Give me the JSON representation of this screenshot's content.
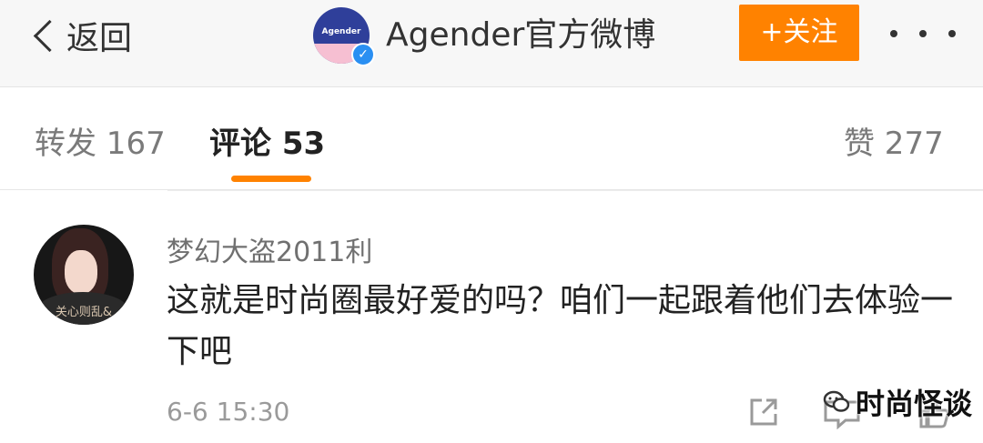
{
  "header": {
    "back_label": "返回",
    "account_avatar_text": "Agender",
    "account_name": "Agender官方微博",
    "follow_label": "+关注"
  },
  "tabs": [
    {
      "label": "转发 167"
    },
    {
      "label": "评论 53"
    },
    {
      "label": "赞 277"
    }
  ],
  "comment": {
    "username": "梦幻大盗2011利",
    "text": "这就是时尚圈最好爱的吗？咱们一起跟着他们去体验一下吧",
    "time": "6-6 15:30",
    "avatar_caption": "关心则乱&"
  },
  "watermark": {
    "label": "时尚怪谈"
  },
  "colors": {
    "accent": "#ff8200",
    "verified": "#2a8ff2"
  }
}
